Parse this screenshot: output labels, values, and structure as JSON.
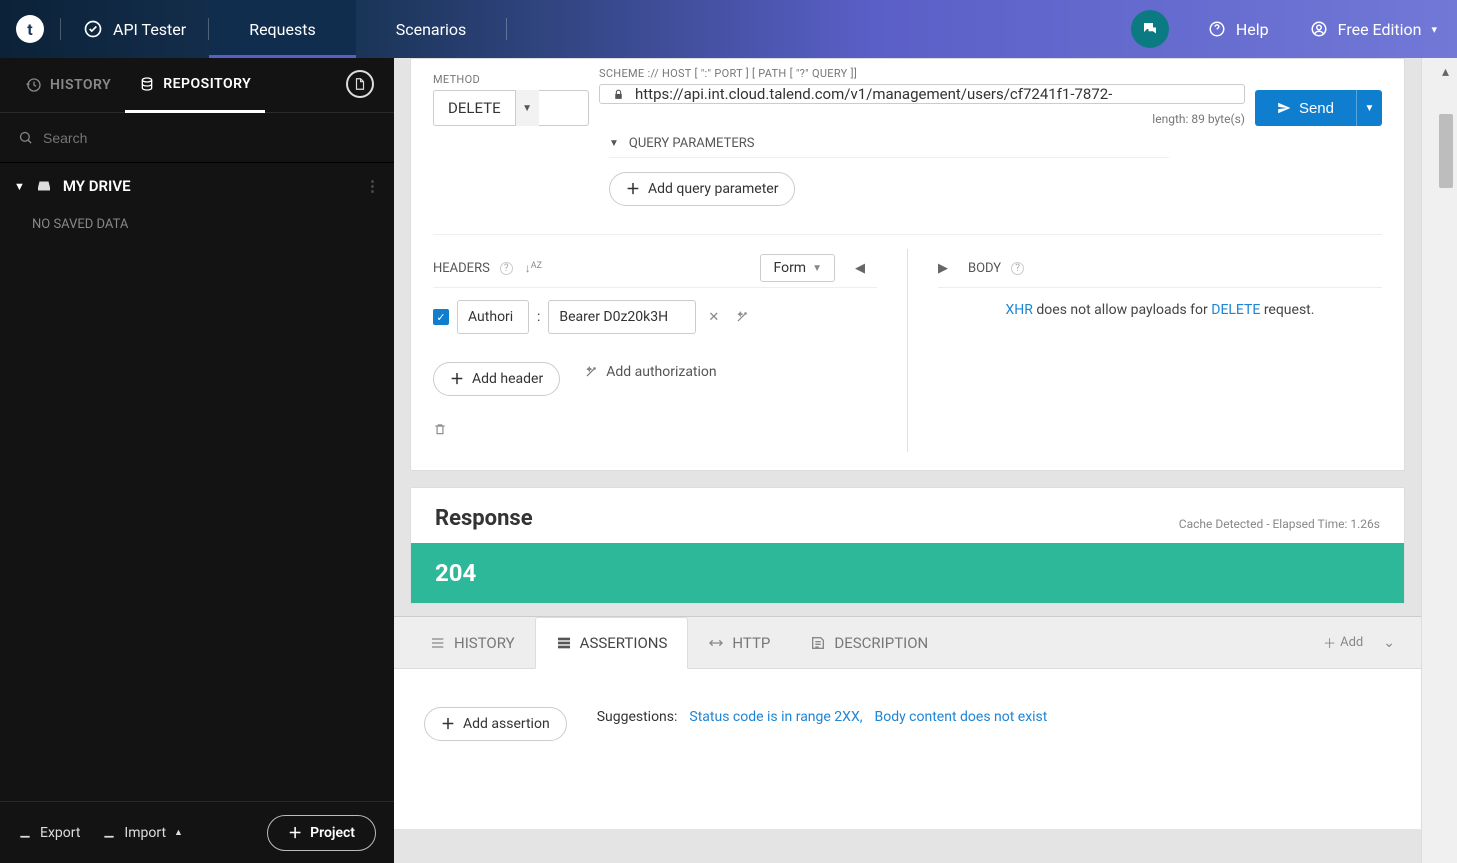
{
  "topbar": {
    "appName": "API Tester",
    "tabs": {
      "requests": "Requests",
      "scenarios": "Scenarios"
    },
    "help": "Help",
    "edition": "Free Edition"
  },
  "sidebar": {
    "tabs": {
      "history": "HISTORY",
      "repository": "REPOSITORY"
    },
    "searchPlaceholder": "Search",
    "drive": "MY DRIVE",
    "noSaved": "NO SAVED DATA",
    "export": "Export",
    "import": "Import",
    "project": "Project"
  },
  "request": {
    "methodLabel": "METHOD",
    "urlLabel": "SCHEME :// HOST [ \":\" PORT ] [ PATH [ \"?\" QUERY ]]",
    "method": "DELETE",
    "url": "https://api.int.cloud.talend.com/v1/management/users/cf7241f1-7872-",
    "lengthText": "length: 89 byte(s)",
    "send": "Send",
    "queryParams": "QUERY PARAMETERS",
    "addQueryParam": "Add query parameter",
    "headersTitle": "HEADERS",
    "formMode": "Form",
    "headerName": "Authori",
    "headerValue": "Bearer D0z20k3H",
    "addHeader": "Add header",
    "addAuth": "Add authorization",
    "bodyTitle": "BODY",
    "bodyMsgPre": "XHR",
    "bodyMsgMid": " does not allow payloads for ",
    "bodyMsgMethod": "DELETE",
    "bodyMsgPost": " request."
  },
  "response": {
    "title": "Response",
    "meta": "Cache Detected - Elapsed Time: 1.26s",
    "status": "204"
  },
  "bottom": {
    "tabs": {
      "history": "HISTORY",
      "assertions": "ASSERTIONS",
      "http": "HTTP",
      "description": "DESCRIPTION"
    },
    "add": "Add",
    "addAssertion": "Add assertion",
    "suggestions": "Suggestions:",
    "sug1": "Status code is in range 2XX,",
    "sug2": "Body content does not exist"
  }
}
